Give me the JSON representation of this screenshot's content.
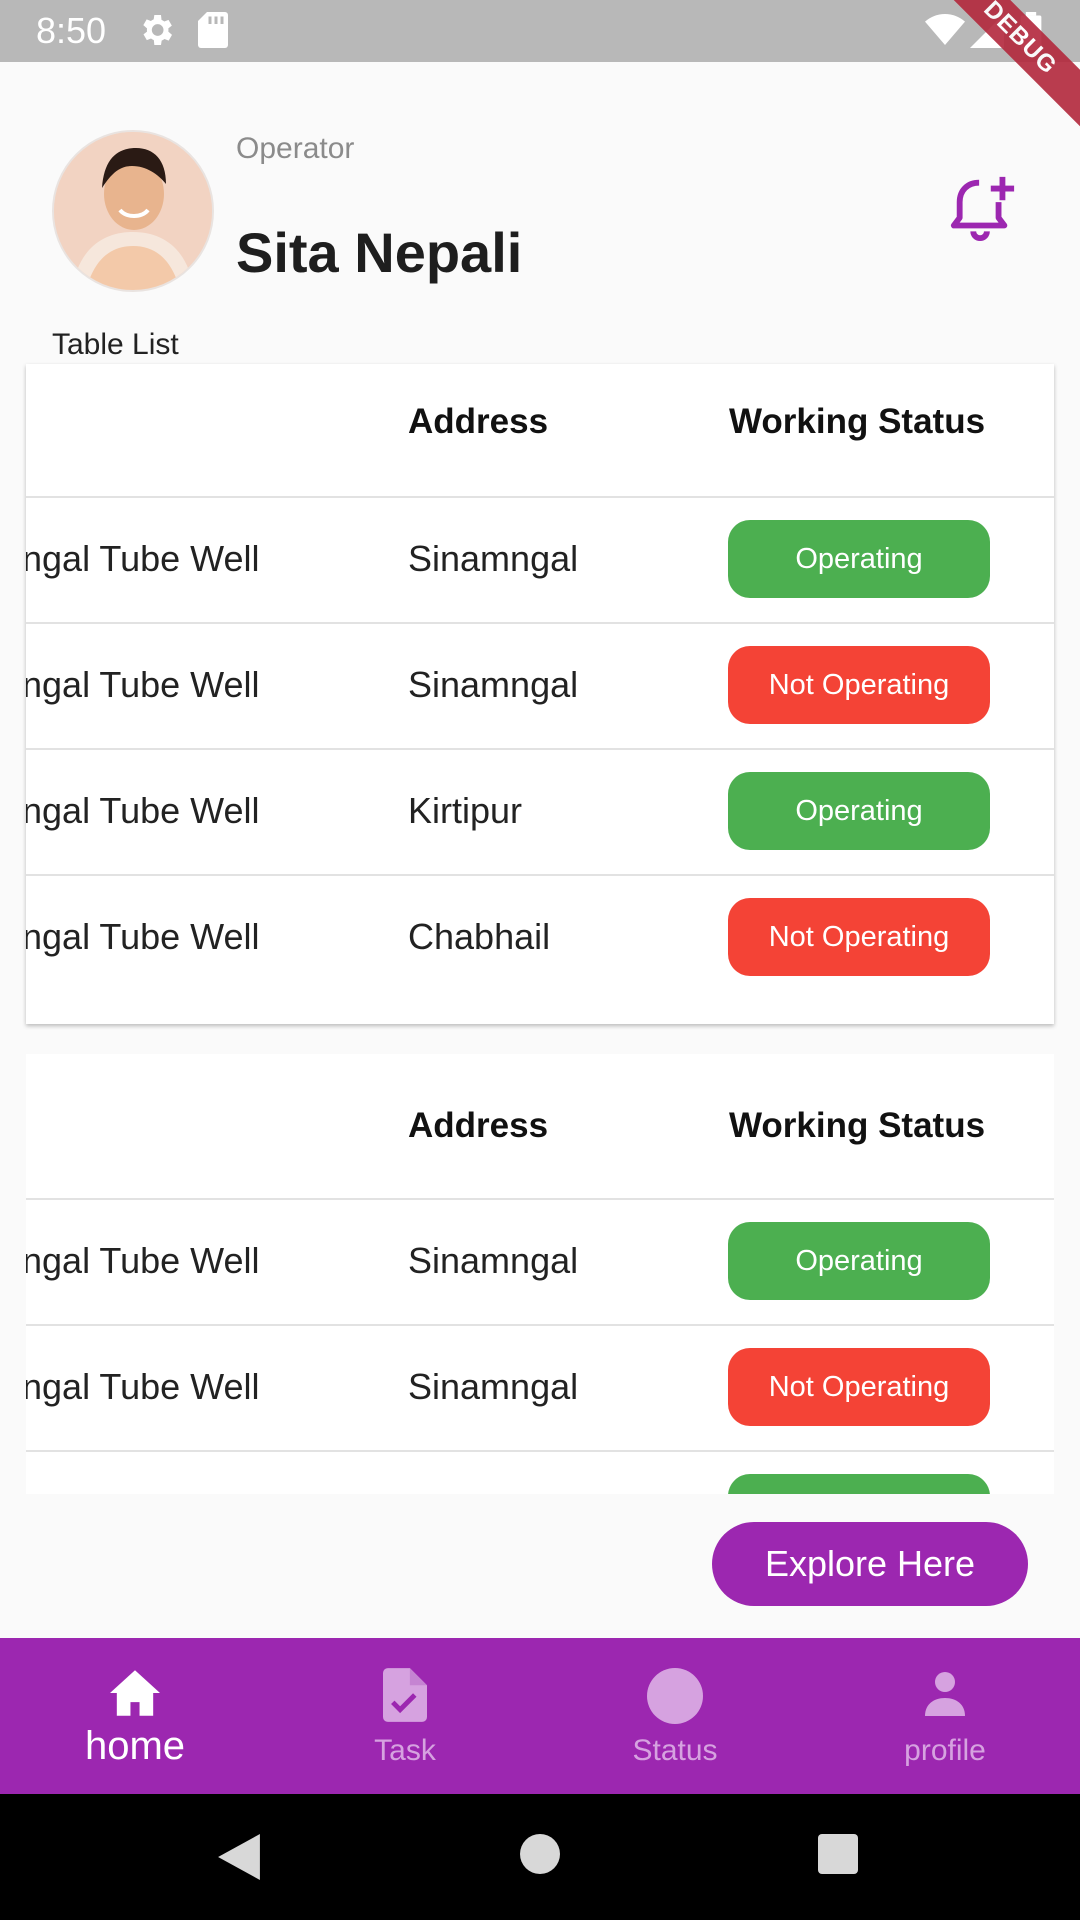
{
  "status_bar": {
    "time": "8:50",
    "debug": "DEBUG"
  },
  "header": {
    "role": "Operator",
    "name": "Sita Nepali"
  },
  "section_label": "Table List",
  "columns": {
    "address": "Address",
    "status": "Working Status"
  },
  "table1": [
    {
      "name": "ngal Tube Well",
      "address": "Sinamngal",
      "status": "Operating",
      "state": "ok"
    },
    {
      "name": "ngal Tube Well",
      "address": "Sinamngal",
      "status": "Not Operating",
      "state": "bad"
    },
    {
      "name": "ngal Tube Well",
      "address": "Kirtipur",
      "status": "Operating",
      "state": "ok"
    },
    {
      "name": "ngal Tube Well",
      "address": "Chabhail",
      "status": "Not Operating",
      "state": "bad"
    }
  ],
  "table2": [
    {
      "name": "ngal Tube Well",
      "address": "Sinamngal",
      "status": "Operating",
      "state": "ok"
    },
    {
      "name": "ngal Tube Well",
      "address": "Sinamngal",
      "status": "Not Operating",
      "state": "bad"
    }
  ],
  "explore_button": "Explore Here",
  "nav": [
    {
      "label": "home",
      "icon": "home-icon"
    },
    {
      "label": "Task",
      "icon": "task-icon"
    },
    {
      "label": "Status",
      "icon": "status-icon"
    },
    {
      "label": "profile",
      "icon": "person-icon"
    }
  ],
  "colors": {
    "primary": "#9c27b0",
    "ok": "#4caf50",
    "bad": "#f44336"
  }
}
